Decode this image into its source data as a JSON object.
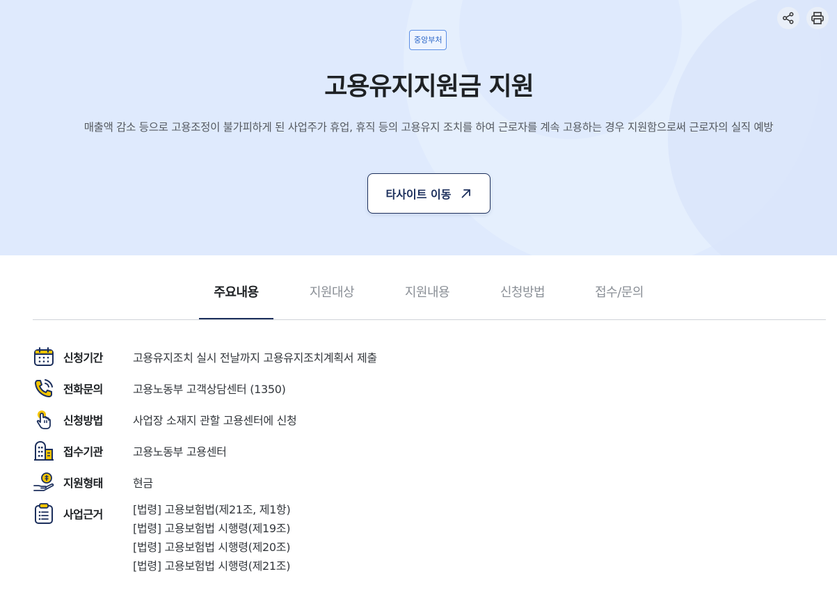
{
  "header": {
    "badge": "중앙부처",
    "title": "고용유지지원금 지원",
    "description": "매출액 감소 등으로 고용조정이 불가피하게 된 사업주가 휴업, 휴직 등의 고용유지 조치를 하여 근로자를 계속 고용하는 경우 지원함으로써 근로자의 실직 예방",
    "site_button": "타사이트 이동",
    "actions": {
      "share_icon": "share-icon",
      "print_icon": "print-icon"
    }
  },
  "tabs": [
    {
      "label": "주요내용",
      "active": true
    },
    {
      "label": "지원대상",
      "active": false
    },
    {
      "label": "지원내용",
      "active": false
    },
    {
      "label": "신청방법",
      "active": false
    },
    {
      "label": "접수/문의",
      "active": false
    }
  ],
  "summary": {
    "period": {
      "icon": "calendar-icon",
      "label": "신청기간",
      "value": "고용유지조치 실시 전날까지 고용유지조치계획서 제출"
    },
    "phone": {
      "icon": "phone-icon",
      "label": "전화문의",
      "value": "고용노동부 고객상담센터 (1350)"
    },
    "method": {
      "icon": "hand-pointer-icon",
      "label": "신청방법",
      "value": "사업장 소재지 관할 고용센터에 신청"
    },
    "agency": {
      "icon": "building-icon",
      "label": "접수기관",
      "value": "고용노동부 고용센터"
    },
    "type": {
      "icon": "money-hand-icon",
      "label": "지원형태",
      "value": "현금"
    },
    "basis": {
      "icon": "clipboard-list-icon",
      "label": "사업근거",
      "values": [
        "[법령] 고용보험법(제21조, 제1항)",
        "[법령] 고용보험법 시행령(제19조)",
        "[법령] 고용보험법 시행령(제20조)",
        "[법령] 고용보험법 시행령(제21조)"
      ]
    }
  },
  "colors": {
    "hero_bg": "#dfeafd",
    "accent": "#1c2f5c",
    "icon_yellow": "#f5c400"
  }
}
